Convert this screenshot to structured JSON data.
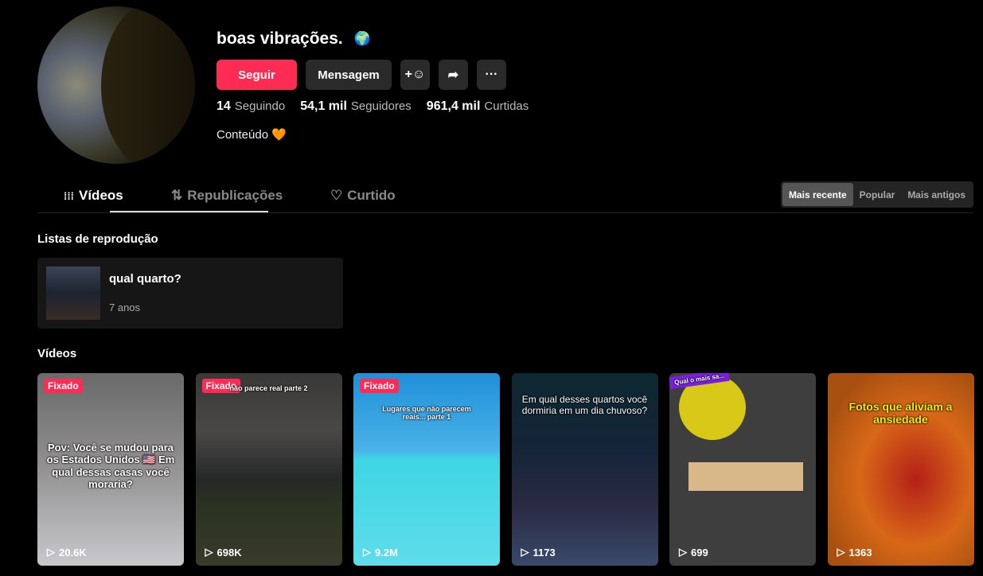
{
  "profile": {
    "name": "boas vibrações.",
    "name_emoji": "🌍",
    "bio": "Conteúdo 🧡"
  },
  "buttons": {
    "follow": "Seguir",
    "message": "Mensagem",
    "add_friend_icon": "person-plus-icon",
    "share_icon": "share-icon",
    "more": "···"
  },
  "stats": [
    {
      "value": "14",
      "label": "Seguindo"
    },
    {
      "value": "54,1 mil",
      "label": "Seguidores"
    },
    {
      "value": "961,4 mil",
      "label": "Curtidas"
    }
  ],
  "tabs": [
    {
      "icon": "⁞⁞⁞",
      "label": "Vídeos"
    },
    {
      "icon": "⇅",
      "label": "Republicações"
    },
    {
      "icon": "♡",
      "label": "Curtido"
    }
  ],
  "sort": [
    "Mais recente",
    "Popular",
    "Mais antigos"
  ],
  "playlists_title": "Listas de reprodução",
  "playlist": {
    "title": "qual quarto?",
    "subtitle": "7 anos"
  },
  "videos_title": "Vídeos",
  "videos": [
    {
      "badge": "Fixado",
      "caption": "Pov: Você se mudou para os Estados Unidos 🇺🇸 Em qual dessas casas você moraria?",
      "views": "20.6K"
    },
    {
      "badge": "Fixado",
      "caption": "não parece real parte 2",
      "views": "698K"
    },
    {
      "badge": "Fixado",
      "caption": "Lugares que não parecem reais... parte 1",
      "views": "9.2M"
    },
    {
      "badge": "",
      "caption": "Em qual desses quartos você dormiria em um dia chuvoso?",
      "views": "1173"
    },
    {
      "badge": "",
      "caption": "Qual o mais sa...",
      "views": "699"
    },
    {
      "badge": "",
      "caption": "Fotos que aliviam a ansiedade",
      "views": "1363"
    }
  ]
}
